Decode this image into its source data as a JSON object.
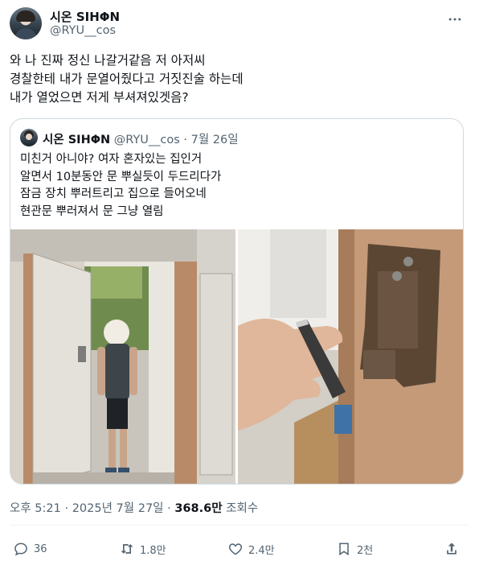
{
  "author": {
    "name": "시온 SIHΦN",
    "handle": "@RYU__cos"
  },
  "tweet": {
    "lines": [
      "와 나 진짜 정신 나갈거같음 저 아저씨",
      "경찰한테 내가 문열어줬다고 거짓진술 하는데",
      "내가 열었으면 저게 부셔져있겟음?"
    ],
    "time": "오후 5:21",
    "date": "2025년 7월 27일",
    "views_count": "368.6만",
    "views_label": "조회수"
  },
  "quote": {
    "name": "시온 SIHΦN",
    "handle": "@RYU__cos",
    "date": "7월 26일",
    "lines": [
      "미친거 아니야? 여자 혼자있는 집인거",
      "알면서 10분동안 문 뿌실듯이 두드리다가",
      "잠금 장치 뿌러트리고 집으로 들어오네",
      "현관문 뿌러져서 문 그냥 열림"
    ]
  },
  "actions": {
    "replies": "36",
    "reposts": "1.8만",
    "likes": "2.4만",
    "bookmarks": "2천"
  }
}
